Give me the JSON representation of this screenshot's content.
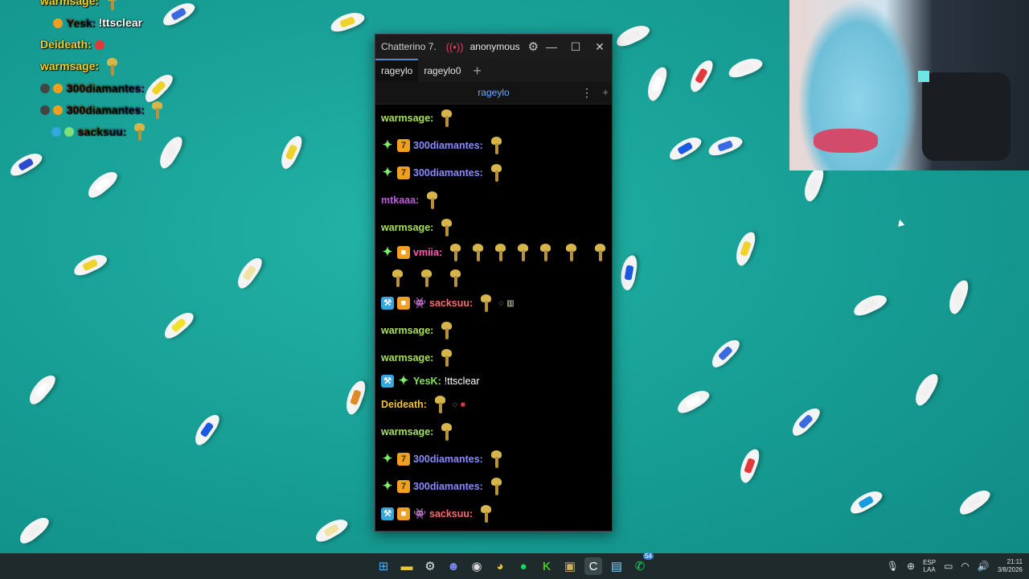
{
  "overlay": {
    "lines": [
      {
        "user": "warmsage:",
        "message": ""
      },
      {
        "user": "Yesk:",
        "message": "!ttsclear"
      },
      {
        "user": "Deideath:",
        "message": ""
      },
      {
        "user": "warmsage:",
        "message": ""
      },
      {
        "user": "300diamantes:",
        "message": ""
      },
      {
        "user": "300diamantes:",
        "message": ""
      },
      {
        "user": "sacksuu:",
        "message": ""
      }
    ]
  },
  "window": {
    "title": "Chatterino 7.",
    "live_icon": "live-icon",
    "account": "anonymous",
    "tabs": [
      {
        "label": "rageylo"
      },
      {
        "label": "rageylo0"
      }
    ],
    "channel": "rageylo",
    "colors": {
      "accent": "#4b8ad6",
      "channel_link": "#6aa6ff"
    }
  },
  "messages": [
    {
      "user": "warmsage:",
      "color": "#a8e05a",
      "text": ""
    },
    {
      "user": "300diamantes:",
      "color": "#8a8aff",
      "text": ""
    },
    {
      "user": "300diamantes:",
      "color": "#8a8aff",
      "text": ""
    },
    {
      "user": "mtkaaa:",
      "color": "#c05ae0",
      "text": ""
    },
    {
      "user": "warmsage:",
      "color": "#a8e05a",
      "text": ""
    },
    {
      "user": "vmiia:",
      "color": "#ff5ab4",
      "text": ""
    },
    {
      "user": "sacksuu:",
      "color": "#ff6a6a",
      "text": ""
    },
    {
      "user": "warmsage:",
      "color": "#a8e05a",
      "text": ""
    },
    {
      "user": "warmsage:",
      "color": "#a8e05a",
      "text": ""
    },
    {
      "user": "YesK:",
      "color": "#8ae05a",
      "text": "!ttsclear"
    },
    {
      "user": "Deideath:",
      "color": "#f0c23a",
      "text": ""
    },
    {
      "user": "warmsage:",
      "color": "#a8e05a",
      "text": ""
    },
    {
      "user": "300diamantes:",
      "color": "#8a8aff",
      "text": ""
    },
    {
      "user": "300diamantes:",
      "color": "#8a8aff",
      "text": ""
    },
    {
      "user": "sacksuu:",
      "color": "#ff6a6a",
      "text": ""
    }
  ],
  "taskbar": {
    "apps": [
      "windows-icon",
      "file-explorer-icon",
      "steam-icon",
      "discord-icon",
      "obs-icon",
      "chrome-icon",
      "spotify-icon",
      "kick-icon",
      "game-icon",
      "chatterino-icon",
      "notepad-icon",
      "whatsapp-icon"
    ],
    "whatsapp_badge": "54",
    "lang_top": "ESP",
    "lang_bottom": "LAA",
    "time": "21:11",
    "date": "3/8/2026"
  }
}
